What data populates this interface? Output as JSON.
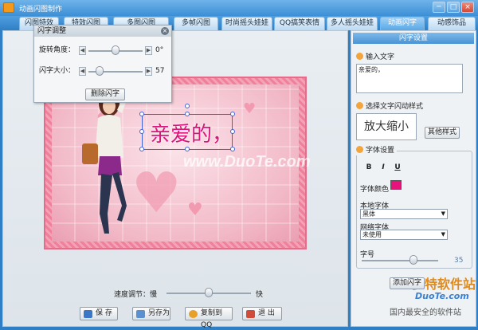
{
  "window": {
    "title": "动画闪图制作",
    "buttons": [
      "─",
      "□",
      "×"
    ]
  },
  "tabs": [
    {
      "label": "闪图特效",
      "active": false
    },
    {
      "label": "特效闪图",
      "active": false
    },
    {
      "label": "多图闪图",
      "active": false
    },
    {
      "label": "多帧闪图",
      "active": false
    },
    {
      "label": "时尚摇头娃娃",
      "active": false
    },
    {
      "label": "QQ搞笑表情",
      "active": false
    },
    {
      "label": "多人摇头娃娃",
      "active": false
    },
    {
      "label": "动画闪字",
      "active": true
    },
    {
      "label": "动感饰品",
      "active": false
    }
  ],
  "popup": {
    "title": "闪字调整",
    "close": "×",
    "rotate_label": "旋转角度：",
    "rotate_value": "0°",
    "rotate_level": 0.5,
    "size_label": "闪字大小：",
    "size_value": "57",
    "size_level": 0.2,
    "delete_button": "删除闪字"
  },
  "canvas": {
    "flash_text": "亲爱的，",
    "watermark": "www.DuoTe.com"
  },
  "speed": {
    "label": "速度调节：慢",
    "fast": "快",
    "level": 0.5
  },
  "bottom_buttons": [
    {
      "label": "保  存",
      "color": "#3b77c9"
    },
    {
      "label": "另存为",
      "color": "#5a8fd0"
    },
    {
      "label": "复制到QQ",
      "color": "#e6a12a"
    },
    {
      "label": "退  出",
      "color": "#d14b3b"
    }
  ],
  "side": {
    "header": "闪字设置",
    "input_title": "输入文字",
    "input_value": "亲爱的，",
    "style_title": "选择文字闪动样式",
    "style_preview": "放大缩小",
    "other_style_button": "其他样式",
    "font_title": "字体设置",
    "bold": "B",
    "italic": "I",
    "underline": "U",
    "font_color_label": "字体颜色",
    "font_color": "#e8127c",
    "local_font_label": "本地字体",
    "local_font_value": "黑体",
    "web_font_label": "网络字体",
    "web_font_value": "未使用",
    "size_label": "字号",
    "size_value": "35",
    "size_level": 0.68,
    "add_button": "添加闪字",
    "wm_brand": "多特软件站",
    "wm_url": "DuoTe.com",
    "wm_slogan": "国内最安全的软件站"
  }
}
